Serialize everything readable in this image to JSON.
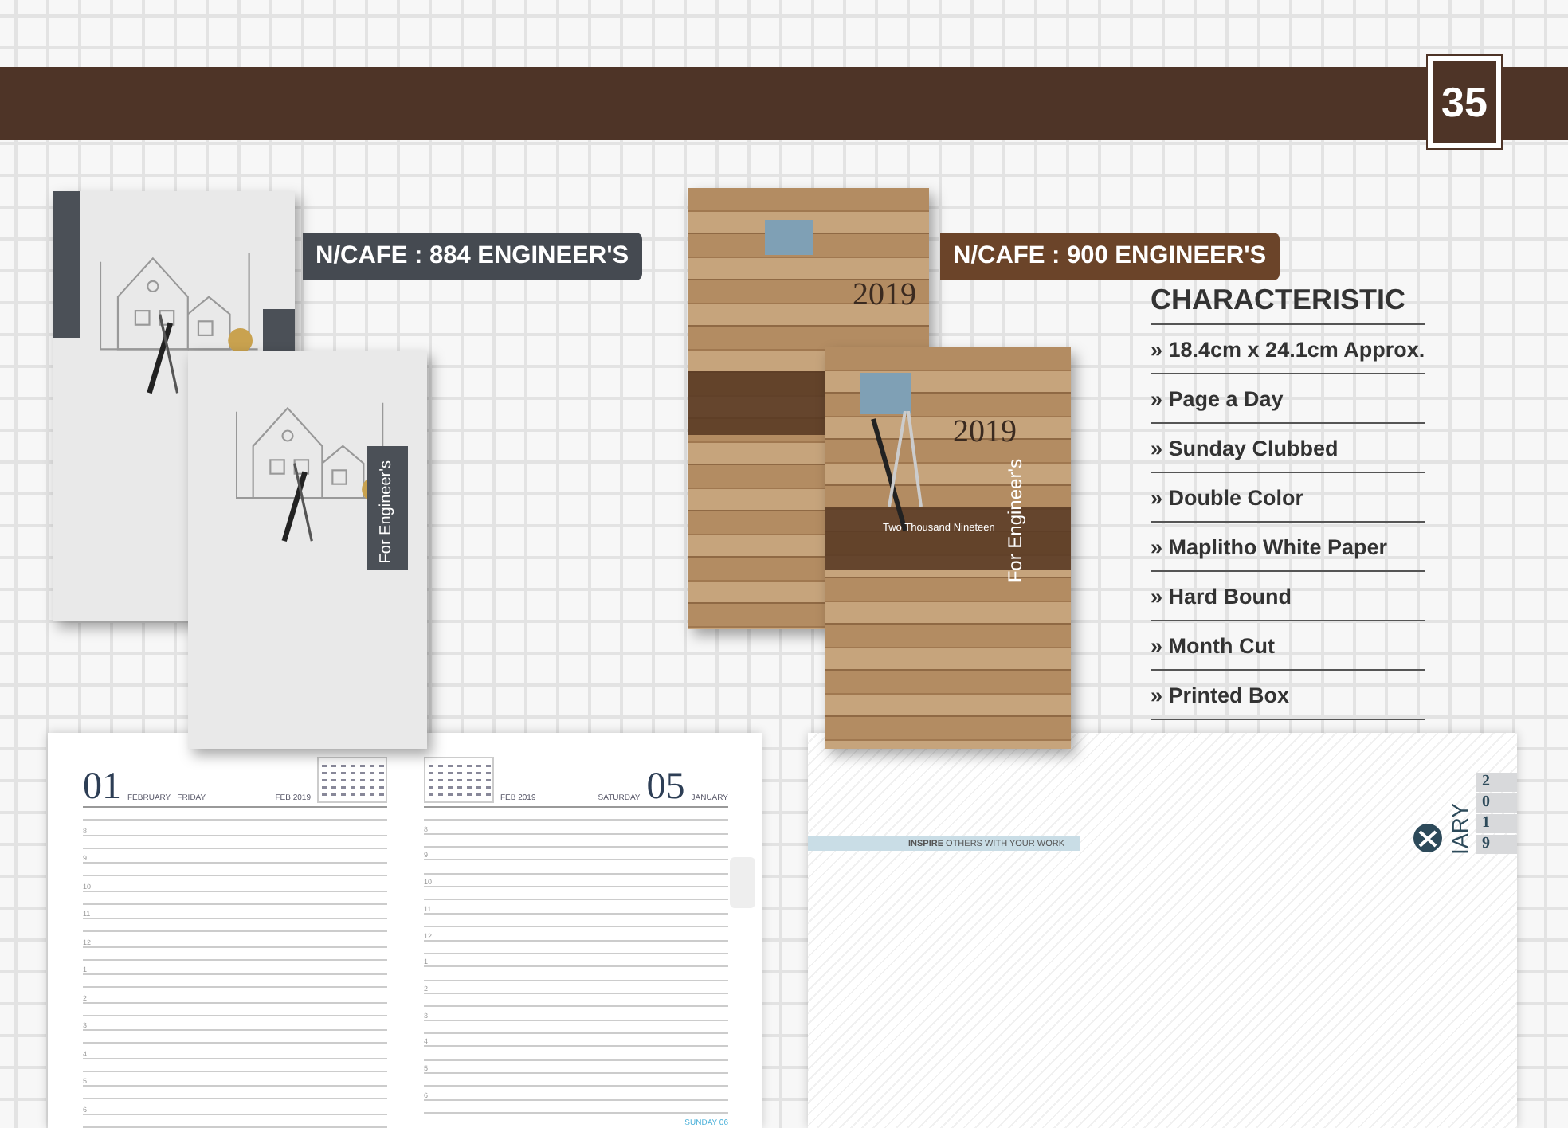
{
  "page_number": "35",
  "products": [
    {
      "kind": "blueprint",
      "code": "N/CAFE : 884 ENGINEER'S",
      "cover_text": "For Engineer's"
    },
    {
      "kind": "wood",
      "code": "N/CAFE : 900 ENGINEER'S",
      "cover_text": "For Engineer's",
      "year": "2019",
      "subtitle": "Two Thousand Nineteen",
      "box_year": "2019"
    }
  ],
  "characteristics": {
    "title": "CHARACTERISTIC",
    "items": [
      "» 18.4cm x 24.1cm Approx.",
      "» Page a Day",
      "» Sunday Clubbed",
      "» Double Color",
      "» Maplitho White Paper",
      "» Hard Bound",
      "» Month Cut",
      "» Printed Box"
    ]
  },
  "diary_spread": {
    "pages": [
      {
        "day_number": "01",
        "month": "FEBRUARY",
        "weekday": "FRIDAY",
        "calendar_label": "FEB 2019",
        "hours": [
          "8",
          "9",
          "10",
          "11",
          "12",
          "1",
          "2",
          "3",
          "4",
          "5",
          "6"
        ]
      },
      {
        "day_number": "05",
        "month": "JANUARY",
        "weekday": "SATURDAY",
        "calendar_label": "FEB 2019",
        "hours": [
          "8",
          "9",
          "10",
          "11",
          "12",
          "1",
          "2",
          "3",
          "4",
          "5",
          "6"
        ],
        "footer": "SUNDAY 06"
      }
    ]
  },
  "brand_page": {
    "tagline": "**INSPIRE** OTHERS WITH YOUR WORK",
    "logo_text": "IARY",
    "year_digits": [
      "2",
      "0",
      "1",
      "9"
    ]
  }
}
